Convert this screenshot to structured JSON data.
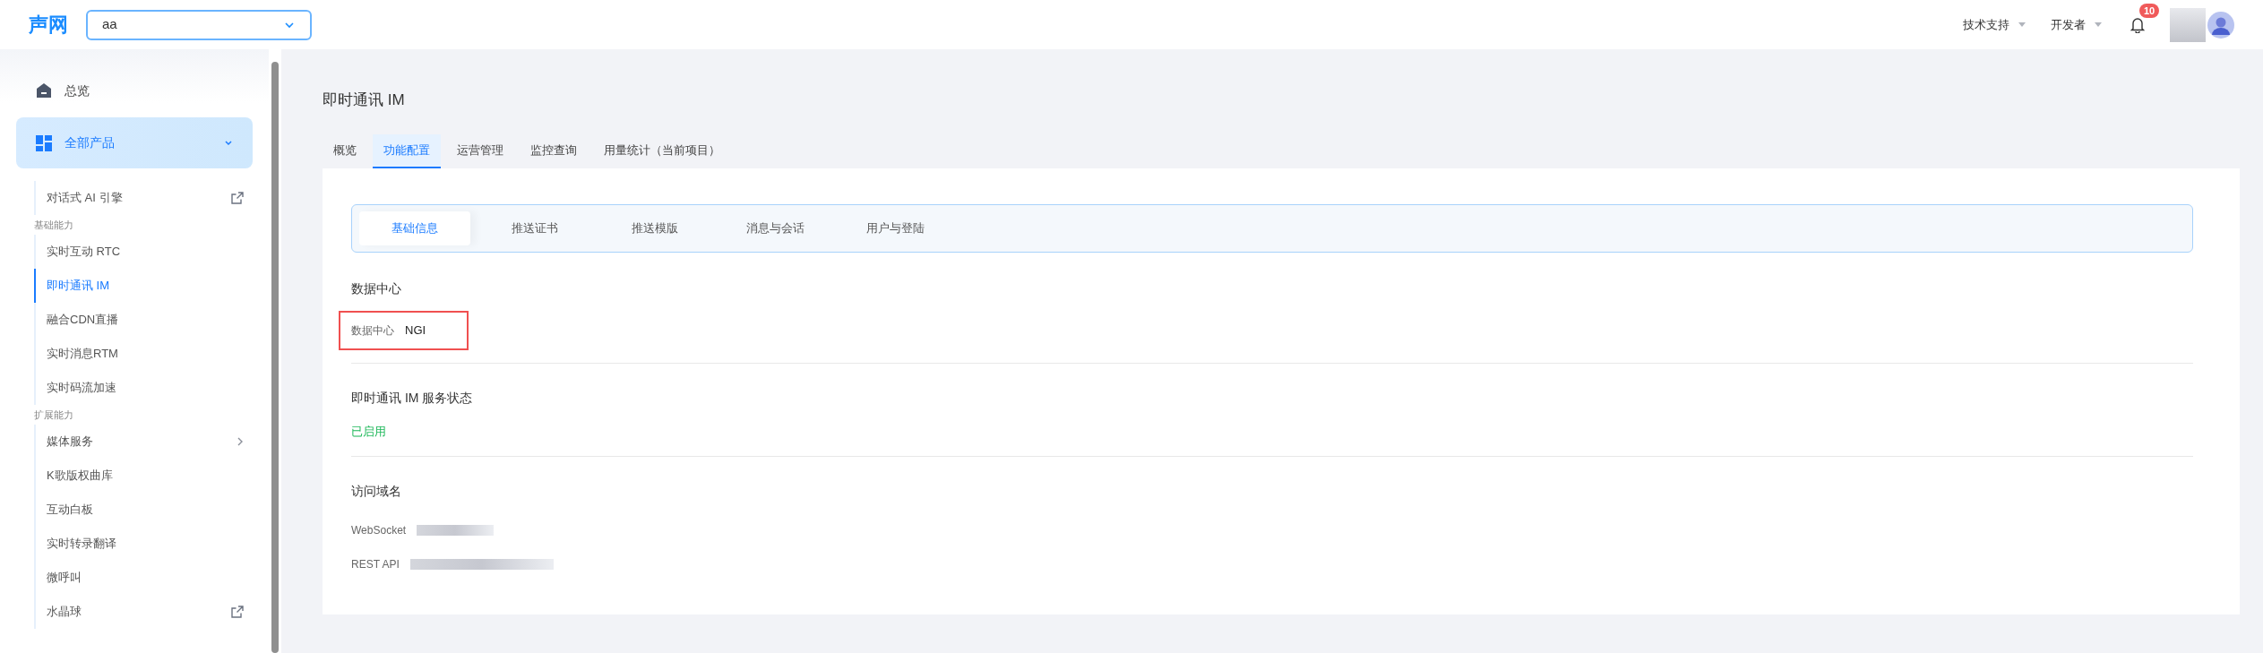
{
  "header": {
    "logo": "声网",
    "project_select": {
      "value": "aa"
    },
    "menus": [
      {
        "label": "技术支持"
      },
      {
        "label": "开发者"
      }
    ],
    "notifications": {
      "badge": "10"
    }
  },
  "sidebar": {
    "overview": {
      "label": "总览"
    },
    "product_menu": {
      "label": "全部产品",
      "expanded": true,
      "children": [
        {
          "kind": "item",
          "label": "对话式 AI 引擎",
          "selected": false,
          "external": true
        },
        {
          "kind": "heading",
          "label": "基础能力"
        },
        {
          "kind": "item",
          "label": "实时互动 RTC",
          "selected": false
        },
        {
          "kind": "item",
          "label": "即时通讯 IM",
          "selected": true
        },
        {
          "kind": "item",
          "label": "融合CDN直播",
          "selected": false
        },
        {
          "kind": "item",
          "label": "实时消息RTM",
          "selected": false
        },
        {
          "kind": "item",
          "label": "实时码流加速",
          "selected": false
        },
        {
          "kind": "heading",
          "label": "扩展能力"
        },
        {
          "kind": "item",
          "label": "媒体服务",
          "selected": false,
          "submenu": true
        },
        {
          "kind": "item",
          "label": "K歌版权曲库",
          "selected": false
        },
        {
          "kind": "item",
          "label": "互动白板",
          "selected": false
        },
        {
          "kind": "item",
          "label": "实时转录翻译",
          "selected": false
        },
        {
          "kind": "item",
          "label": "微呼叫",
          "selected": false
        },
        {
          "kind": "item",
          "label": "水晶球",
          "selected": false,
          "external": true
        }
      ]
    }
  },
  "page_title": "即时通讯 IM",
  "tabs": [
    {
      "label": "概览",
      "selected": false
    },
    {
      "label": "功能配置",
      "selected": true
    },
    {
      "label": "运营管理",
      "selected": false
    },
    {
      "label": "监控查询",
      "selected": false
    },
    {
      "label": "用量统计（当前项目）",
      "selected": false
    }
  ],
  "subtabs": [
    {
      "label": "基础信息",
      "selected": true
    },
    {
      "label": "推送证书",
      "selected": false
    },
    {
      "label": "推送模版",
      "selected": false
    },
    {
      "label": "消息与会话",
      "selected": false
    },
    {
      "label": "用户与登陆",
      "selected": false
    }
  ],
  "sections": [
    {
      "title": "数据中心",
      "rows": [
        {
          "kind": "field",
          "label": "数据中心",
          "value": "NGI",
          "highlighted": true
        }
      ]
    },
    {
      "title": "即时通讯 IM 服务状态",
      "rows": [
        {
          "kind": "status",
          "label": "已启用"
        }
      ]
    },
    {
      "title": "访问域名",
      "rows": [
        {
          "kind": "redacted",
          "label": "WebSocket"
        },
        {
          "kind": "redacted",
          "label": "REST API"
        }
      ]
    }
  ]
}
